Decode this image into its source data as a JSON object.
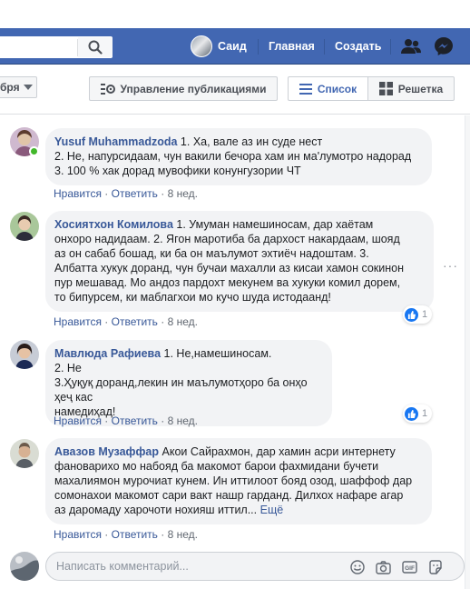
{
  "topbar": {
    "user_name": "Саид",
    "home_label": "Главная",
    "create_label": "Создать"
  },
  "toolbar": {
    "month_value": "бря",
    "manage_label": "Управление публикациями",
    "list_label": "Список",
    "grid_label": "Решетка"
  },
  "comments": [
    {
      "author": "Yusuf Muhammadzoda",
      "lines": [
        "1. Ха, вале аз ин суде нест",
        "2. Не, напурсидаам, чун вакили бечора хам ин ма'лумотро надорад",
        "3. 100 % хак дорад мувофики конунгузории ЧТ"
      ],
      "like": "Нравится",
      "reply": "Ответить",
      "time": "8 нед.",
      "online": true
    },
    {
      "author": "Хосиятхон Комилова",
      "lines": [
        "1. Умуман намешиносам, дар хаётам",
        "онхоро надидаам. 2. Ягон маротиба ба дархост накардаам, шояд",
        "аз он сабаб бошад, ки ба он маълумот эхтиёч надоштам. 3.",
        "Албатта хукук доранд, чун бучаи махалли аз кисаи хамон сокинон",
        "пур мешавад. Мо андоз пардохт мекунем ва хукуки комил дорем,",
        "то бипурсем, ки маблагхои мо кучо шуда истодаанд!"
      ],
      "like": "Нравится",
      "reply": "Ответить",
      "time": "8 нед.",
      "reactions": "1"
    },
    {
      "author": "Мавлюда Рафиева",
      "lines": [
        "1. Не,намешиносам.",
        "2. Не",
        "3.Ҳуқуқ доранд,лекин ин маълумотҳоро ба онҳо ҳеҷ кас",
        "намедиҳад!"
      ],
      "like": "Нравится",
      "reply": "Ответить",
      "time": "8 нед.",
      "reactions": "1"
    },
    {
      "author": "Авазов Музаффар",
      "lines": [
        "Акои Сайрахмон, дар хамин асри интернету",
        "фановарихо мо набояд ба макомот барои фахмидани бучети",
        "махалиямон мурочиат кунем. Ин иттилоот бояд озод, шаффоф дар",
        "сомонахои макомот сари вакт нашр гарданд. Дилхох нафаре агар",
        "аз даромаду харочоти нохияш иттил..."
      ],
      "more": "Ещё",
      "like": "Нравится",
      "reply": "Ответить",
      "time": "8 нед."
    }
  ],
  "composer": {
    "placeholder": "Написать комментарий..."
  },
  "colors": {
    "brand_blue": "#4267b2",
    "link_blue": "#385898",
    "bubble_gray": "#f2f3f5"
  }
}
